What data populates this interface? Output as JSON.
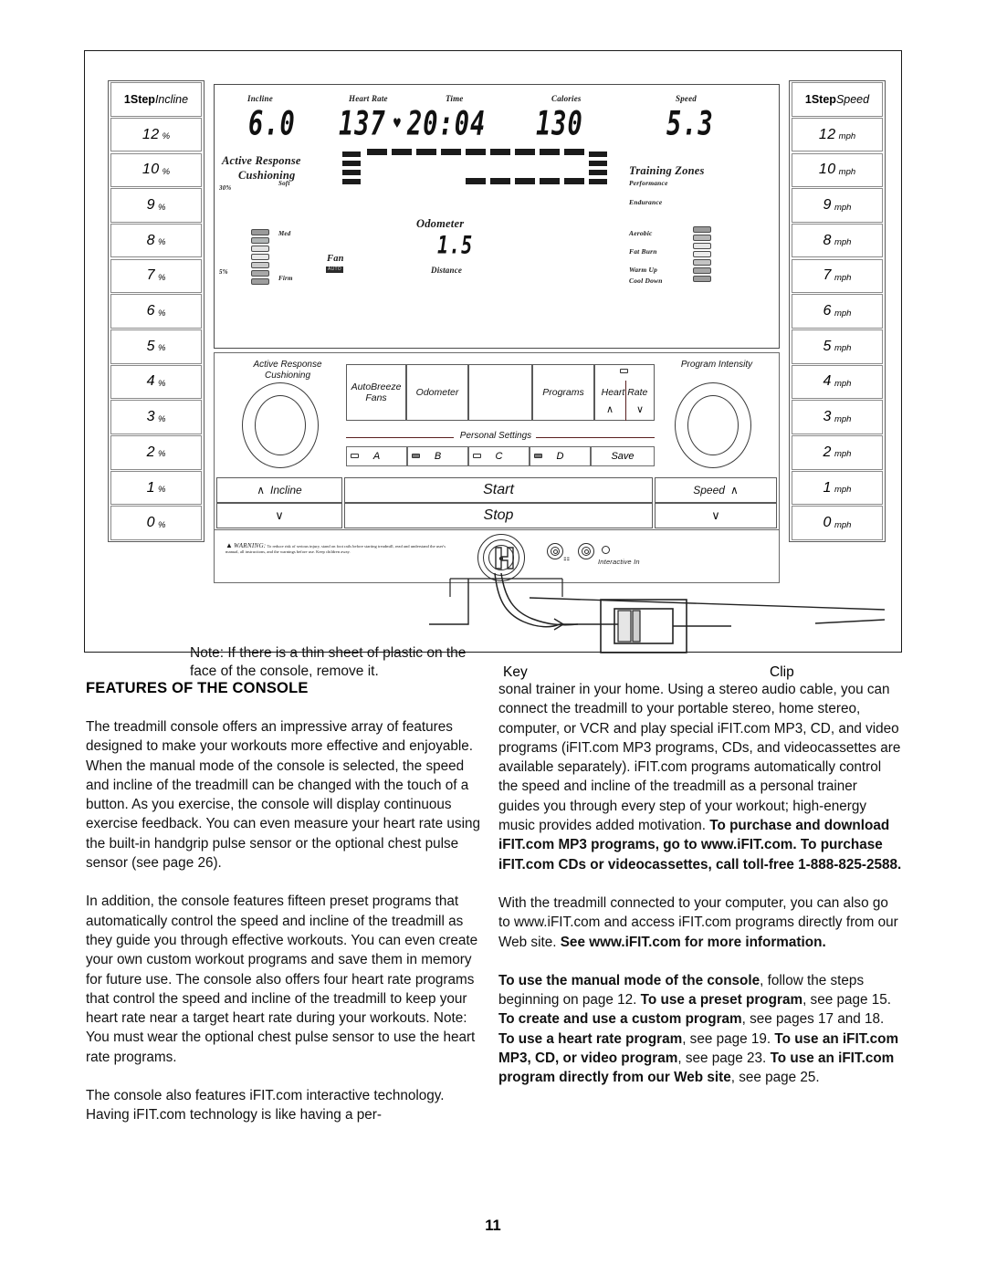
{
  "page": {
    "number": "11",
    "section_heading": "FEATURES OF THE CONSOLE"
  },
  "figure": {
    "note": "Note: If there is a thin sheet of plastic on the face of the console, remove it.",
    "callouts": {
      "key": "Key",
      "clip": "Clip"
    },
    "warning": {
      "title": "WARNING:",
      "text": "To reduce risk of serious injury, stand on foot rails before starting treadmill, read and understand the user's manual, all instructions, and the warnings before use.  Keep children away."
    },
    "incline_column": {
      "header_bold": "1Step",
      "header_italic": "Incline",
      "unit": "%",
      "values": [
        "12",
        "10",
        "9",
        "8",
        "7",
        "6",
        "5",
        "4",
        "3",
        "2",
        "1",
        "0"
      ]
    },
    "speed_column": {
      "header_bold": "1Step",
      "header_italic": "Speed",
      "unit": "mph",
      "values": [
        "12",
        "10",
        "9",
        "8",
        "7",
        "6",
        "5",
        "4",
        "3",
        "2",
        "1",
        "0"
      ]
    },
    "lcd": {
      "incline_label": "Incline",
      "incline_value": "6.0",
      "heart_rate_label": "Heart Rate",
      "heart_rate_value": "137",
      "heart_symbol": "♥",
      "time_label": "Time",
      "time_value": "20:04",
      "calories_label": "Calories",
      "calories_value": "130",
      "speed_label": "Speed",
      "speed_value": "5.3",
      "odometer_label": "Odometer",
      "odometer_value": "1.5",
      "distance_label": "Distance",
      "cushioning_title_line1": "Active Response",
      "cushioning_title_line2": "Cushioning",
      "cushioning_top_pct": "30%",
      "cushioning_bottom_pct": "5%",
      "cushioning_soft": "Soft",
      "cushioning_med": "Med",
      "cushioning_firm": "Firm",
      "fan_label": "Fan",
      "fan_badge": "AUTO",
      "training_zones_title": "Training Zones",
      "training_zones": [
        "Performance",
        "Endurance",
        "Aerobic",
        "Fat Burn",
        "Warm Up",
        "Cool Down"
      ]
    },
    "deck": {
      "cushioning_knob_line1": "Active Response",
      "cushioning_knob_line2": "Cushioning",
      "program_intensity_label": "Program Intensity",
      "buttons": [
        {
          "line1": "AutoBreeze",
          "line2": "Fans"
        },
        {
          "line1": "Odometer",
          "line2": ""
        },
        {
          "line1": "",
          "line2": ""
        },
        {
          "line1": "Programs",
          "line2": ""
        },
        {
          "line1": "Heart Rate",
          "line2": ""
        }
      ],
      "heart_rate_up": "∧",
      "heart_rate_down": "∨",
      "personal_settings_label": "Personal Settings",
      "personal_settings": [
        "A",
        "B",
        "C",
        "D"
      ],
      "save_label": "Save",
      "incline_up": "Incline",
      "start_label": "Start",
      "stop_label": "Stop",
      "speed_up": "Speed",
      "chevron_up": "∧",
      "chevron_down": "∨",
      "interactive_in_label": "Interactive In"
    }
  },
  "body": {
    "left": [
      "The treadmill console offers an impressive array of features designed to make your workouts more effective and enjoyable. When the manual mode of the console is selected, the speed and incline of the treadmill can be changed with the touch of a button. As you exercise, the console will display continuous exercise feedback. You can even measure your heart rate using the built-in handgrip pulse sensor or the optional chest pulse sensor (see page 26).",
      "In addition, the console features fifteen preset programs that automatically control the speed and incline of the treadmill as they guide you through effective workouts. You can even create your own custom workout programs and save them in memory for future use. The console also offers four heart rate programs that control the speed and incline of the treadmill to keep your heart rate near a target heart rate during your workouts. Note: You must wear the optional chest pulse sensor to use the heart rate programs.",
      "The console also features iFIT.com interactive technology. Having iFIT.com technology is like having a per-"
    ],
    "right_p1_plain": "sonal trainer in your home. Using a stereo audio cable, you can connect the treadmill to your portable stereo, home stereo, computer, or VCR and play special iFIT.com MP3, CD, and video programs (iFIT.com MP3 programs, CDs, and videocassettes are available separately). iFIT.com programs automatically control the speed and incline of the treadmill as a personal trainer guides you through every step of your workout; high-energy music provides added motivation. ",
    "right_p1_bold": "To purchase and download iFIT.com MP3 programs, go to www.iFIT.com. To purchase iFIT.com CDs or videocassettes, call toll-free 1-888-825-2588.",
    "right_p2_plain": "With the treadmill connected to your computer, you can also go to www.iFIT.com and access iFIT.com programs directly from our Web site. ",
    "right_p2_bold": "See www.iFIT.com for more information.",
    "right_p3": [
      {
        "text": "To use the manual mode of the console",
        "bold": true
      },
      {
        "text": ", follow the steps beginning on page 12. ",
        "bold": false
      },
      {
        "text": "To use a preset program",
        "bold": true
      },
      {
        "text": ", see page 15. ",
        "bold": false
      },
      {
        "text": "To create and use a custom program",
        "bold": true
      },
      {
        "text": ", see pages 17 and 18. ",
        "bold": false
      },
      {
        "text": "To use a heart rate program",
        "bold": true
      },
      {
        "text": ", see page 19. ",
        "bold": false
      },
      {
        "text": "To use an iFIT.com MP3, CD, or video program",
        "bold": true
      },
      {
        "text": ", see page 23. ",
        "bold": false
      },
      {
        "text": "To use an iFIT.com program directly from our Web site",
        "bold": true
      },
      {
        "text": ", see page 25.",
        "bold": false
      }
    ]
  }
}
